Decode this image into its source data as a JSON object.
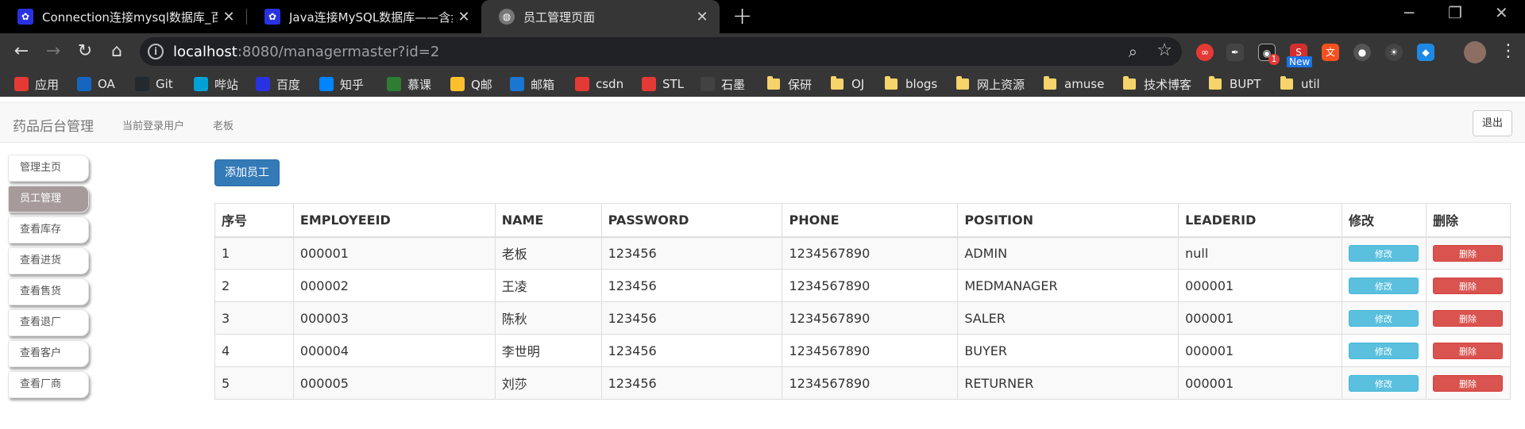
{
  "browser": {
    "tabs": [
      {
        "title": "Connection连接mysql数据库_百",
        "favicon": "baidu-icon",
        "active": false
      },
      {
        "title": "Java连接MySQL数据库——含步",
        "favicon": "baidu-icon",
        "active": false
      },
      {
        "title": "员工管理页面",
        "favicon": "globe-icon",
        "active": true
      }
    ],
    "new_tab": "+",
    "url_host": "localhost",
    "url_path": ":8080/managermaster?id=2",
    "extension_badge_count": "1",
    "extension_badge_new": "New",
    "bookmarks": [
      {
        "label": "应用",
        "icon": "apps-icon",
        "color": "#e53935"
      },
      {
        "label": "OA",
        "icon": "oa-icon",
        "color": "#1565c0"
      },
      {
        "label": "Git",
        "icon": "github-icon",
        "color": "#24292e"
      },
      {
        "label": "哔站",
        "icon": "bilibili-icon",
        "color": "#00a1d6"
      },
      {
        "label": "百度",
        "icon": "baidu-icon",
        "color": "#2932e1"
      },
      {
        "label": "知乎",
        "icon": "zhihu-icon",
        "color": "#0084ff"
      },
      {
        "label": "慕课",
        "icon": "mooc-icon",
        "color": "#2e7d32"
      },
      {
        "label": "Q邮",
        "icon": "qq-mail-icon",
        "color": "#fbc02d"
      },
      {
        "label": "邮箱",
        "icon": "mail-icon",
        "color": "#1976d2"
      },
      {
        "label": "csdn",
        "icon": "csdn-icon",
        "color": "#e53935"
      },
      {
        "label": "STL",
        "icon": "stl-icon",
        "color": "#e53935"
      },
      {
        "label": "石墨",
        "icon": "shimo-icon",
        "color": "#424242"
      },
      {
        "label": "保研",
        "icon": "folder-icon"
      },
      {
        "label": "OJ",
        "icon": "folder-icon"
      },
      {
        "label": "blogs",
        "icon": "folder-icon"
      },
      {
        "label": "网上资源",
        "icon": "folder-icon"
      },
      {
        "label": "amuse",
        "icon": "folder-icon"
      },
      {
        "label": "技术博客",
        "icon": "folder-icon"
      },
      {
        "label": "BUPT",
        "icon": "folder-icon"
      },
      {
        "label": "util",
        "icon": "folder-icon"
      }
    ]
  },
  "navbar": {
    "brand": "药品后台管理",
    "current_user_label": "当前登录用户",
    "current_user": "老板",
    "logout": "退出"
  },
  "sidebar": {
    "items": [
      {
        "label": "管理主页",
        "active": false
      },
      {
        "label": "员工管理",
        "active": true
      },
      {
        "label": "查看库存",
        "active": false
      },
      {
        "label": "查看进货",
        "active": false
      },
      {
        "label": "查看售货",
        "active": false
      },
      {
        "label": "查看退厂",
        "active": false
      },
      {
        "label": "查看客户",
        "active": false
      },
      {
        "label": "查看厂商",
        "active": false
      }
    ]
  },
  "main": {
    "add_button": "添加员工",
    "table": {
      "headers": [
        "序号",
        "EMPLOYEEID",
        "NAME",
        "PASSWORD",
        "PHONE",
        "POSITION",
        "LEADERID",
        "修改",
        "删除"
      ],
      "edit_label": "修改",
      "delete_label": "删除",
      "rows": [
        [
          "1",
          "000001",
          "老板",
          "123456",
          "1234567890",
          "ADMIN",
          "null"
        ],
        [
          "2",
          "000002",
          "王凌",
          "123456",
          "1234567890",
          "MEDMANAGER",
          "000001"
        ],
        [
          "3",
          "000003",
          "陈秋",
          "123456",
          "1234567890",
          "SALER",
          "000001"
        ],
        [
          "4",
          "000004",
          "李世明",
          "123456",
          "1234567890",
          "BUYER",
          "000001"
        ],
        [
          "5",
          "000005",
          "刘莎",
          "123456",
          "1234567890",
          "RETURNER",
          "000001"
        ]
      ]
    }
  }
}
